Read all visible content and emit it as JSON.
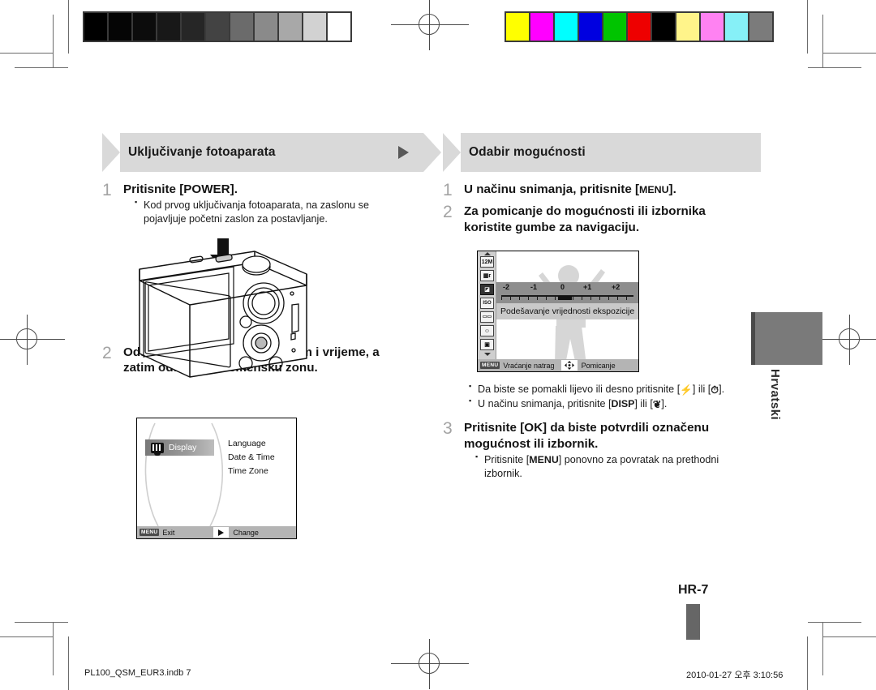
{
  "page": {
    "page_number": "HR-7",
    "side_tab_label": "Hrvatski"
  },
  "footer": {
    "file_name": "PL100_QSM_EUR3.indb   7",
    "timestamp": "2010-01-27   오후 3:10:56"
  },
  "calibration": {
    "grayscale_swatches": [
      "#000000",
      "#050505",
      "#0c0c0c",
      "#181818",
      "#262626",
      "#434343",
      "#6b6b6b",
      "#8a8a8a",
      "#a8a8a8",
      "#d2d2d2",
      "#ffffff"
    ],
    "color_swatches": [
      "#ffff00",
      "#ff00ff",
      "#00ffff",
      "#0000e0",
      "#00c400",
      "#ee0000",
      "#000000",
      "#fff48a",
      "#ff82f2",
      "#86f0f7",
      "#7b7b7b"
    ]
  },
  "left_column": {
    "banner_title": "Uključivanje fotoaparata",
    "banner_arrow_icon": "play-triangle-icon",
    "steps": [
      {
        "num": "1",
        "text_before": "Pritisnite [",
        "key": "POWER",
        "text_after": "].",
        "bullets": [
          "Kod prvog uključivanja fotoaparata, na zaslonu se pojavljuje početni zaslon za postavljanje."
        ]
      },
      {
        "num": "2",
        "text": "Odaberite jezik, postavite datum i vrijeme, a zatim odaberite vremensku zonu.",
        "bullets": []
      }
    ],
    "camera_illustration": {
      "icon": "compact-camera-rear-view-icon",
      "arrow_icon": "down-arrow-icon"
    },
    "display_lcd": {
      "selected_item_label": "Display",
      "selected_item_icon": "display-monitor-icon",
      "menu_items": [
        "Language",
        "Date & Time",
        "Time Zone"
      ],
      "bottom_bar": {
        "menu_chip": "MENU",
        "menu_action": "Exit",
        "right_icon": "right-arrow-icon",
        "right_action": "Change"
      }
    }
  },
  "right_column": {
    "banner_title": "Odabir mogućnosti",
    "steps": [
      {
        "num": "1",
        "text_before": "U načinu snimanja, pritisnite [",
        "key": "MENU",
        "text_after": "]."
      },
      {
        "num": "2",
        "text": "Za pomicanje do mogućnosti ili izbornika koristite gumbe za navigaciju."
      },
      {
        "num": "3",
        "text_before": "Pritisnite [",
        "key": "OK",
        "text_after": "] da biste potvrdili označenu mogućnost ili izbornik.",
        "bullets_after": [
          {
            "pre": "Pritisnite [",
            "key": "MENU",
            "post": "] ponovno za povratak na prethodni izbornik."
          }
        ]
      }
    ],
    "bullets_mid": [
      {
        "pre": "Da biste se pomakli lijevo ili desno pritisnite [",
        "icon1": "flash-bolt-icon",
        "mid": "] ili [",
        "icon2": "timer-icon",
        "post": "]."
      },
      {
        "pre": "U načinu snimanja, pritisnite [",
        "key": "DISP",
        "mid": "] ili [",
        "icon2": "macro-flower-icon",
        "post": "]."
      }
    ],
    "ev_lcd": {
      "rail_icons": [
        {
          "name": "resolution-12m-icon",
          "label": "12M",
          "selected": false
        },
        {
          "name": "quality-fine-icon",
          "label": "",
          "selected": false
        },
        {
          "name": "exposure-value-icon",
          "label": "",
          "selected": true
        },
        {
          "name": "iso-icon",
          "label": "ISO",
          "selected": false
        },
        {
          "name": "white-balance-icon",
          "label": "",
          "selected": false
        },
        {
          "name": "face-detection-off-icon",
          "label": "",
          "selected": false
        },
        {
          "name": "focus-area-icon",
          "label": "",
          "selected": false
        }
      ],
      "scale_labels": [
        "-2",
        "-1",
        "0",
        "+1",
        "+2"
      ],
      "current_value": "0",
      "option_label": "Podešavanje vrijednosti ekspozicije",
      "bottom_bar": {
        "menu_chip": "MENU",
        "menu_action": "Vraćanje natrag",
        "nav_icon": "4-way-navigation-icon",
        "nav_action": "Pomicanje"
      }
    }
  }
}
